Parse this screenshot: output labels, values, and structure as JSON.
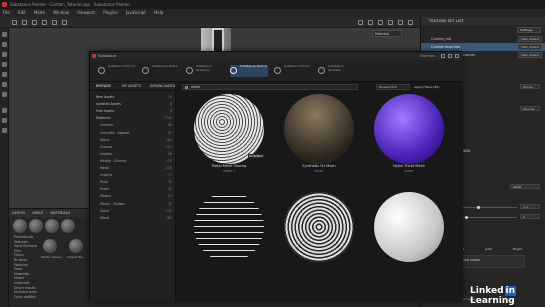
{
  "window": {
    "title": "Substance Painter - Curtain_Tutorial.spp - Substance Painter",
    "menu": [
      "File",
      "Edit",
      "Mode",
      "Window",
      "Viewport",
      "Plugins",
      "JavaScript",
      "Help"
    ]
  },
  "viewport": {
    "mode_dropdown": "Material"
  },
  "layers_panel": {
    "tabs": [
      "LAYERS",
      "SHELF",
      "MATERIALS"
    ],
    "list": [
      "Procedurals",
      "Textures",
      "Hard Surfaces",
      "Skin",
      "Filters",
      "Brushes",
      "Particles",
      "Tools",
      "Materials",
      "Smart materials",
      "Smart masks",
      "Environments",
      "Color profiles"
    ],
    "thumb_labels": [
      "Plastic Glossy",
      "Carpet Wo..."
    ]
  },
  "texture_set": {
    "header": "TEXTURE SET LIST",
    "settings_label": "Settings",
    "rows": [
      {
        "name": "Curtain_mtl",
        "shader": "Main shader",
        "selected": false
      },
      {
        "name": "Curtain machine",
        "shader": "Main shader",
        "selected": true
      },
      {
        "name": "Curtain machine sconces",
        "shader": "Main shader",
        "selected": false
      }
    ],
    "properties_header": "TEXTURE SET SETTINGS",
    "labels": [
      "Base Color",
      "Color selection",
      "Base Color",
      "Color selection",
      "Base Color",
      "Color selection",
      "Opacity",
      "Format",
      "Transparent",
      "Rotation",
      "Scale"
    ],
    "fields": [
      "Sticker",
      "Opacity",
      "sRGB",
      "1.0",
      "0"
    ],
    "buttons": [
      "Save",
      "Load",
      "Auto",
      "Bright"
    ],
    "sections": [
      "Attributes",
      "Channels mapping",
      "Parameters"
    ],
    "notice": "Substance source materials loader",
    "notice_sub": "Plastic Cool base Plaz...",
    "param_label": "Project",
    "param_value": "Select and apply"
  },
  "dialog": {
    "title": "Substance",
    "user": "Brandon",
    "nav": [
      {
        "label": "Substance Source",
        "active": false
      },
      {
        "label": "Substance Share",
        "active": false
      },
      {
        "label": "Substance Academy",
        "active": false
      },
      {
        "label": "Substance Source",
        "active": true
      },
      {
        "label": "Substance Forum",
        "active": false
      },
      {
        "label": "Substance Updates",
        "active": false
      }
    ],
    "side_tabs": [
      "BROWSE",
      "MY ASSETS",
      "DOWNLOADED"
    ],
    "side_rows": [
      {
        "label": "New Assets",
        "count": "10",
        "sub": false
      },
      {
        "label": "Updated Assets",
        "count": "8",
        "sub": false
      },
      {
        "label": "Free Assets",
        "count": "9",
        "sub": false
      },
      {
        "label": "Materials",
        "count": "1740",
        "sub": false
      },
      {
        "label": "Ceramic",
        "count": "66",
        "sub": true
      },
      {
        "label": "Concrete - Asphalt",
        "count": "97",
        "sub": true
      },
      {
        "label": "Fabric",
        "count": "184",
        "sub": true
      },
      {
        "label": "Ground",
        "count": "101",
        "sub": true
      },
      {
        "label": "Leather",
        "count": "58",
        "sub": true
      },
      {
        "label": "Marble - Granite",
        "count": "130",
        "sub": true
      },
      {
        "label": "Metal",
        "count": "216",
        "sub": true
      },
      {
        "label": "Organic",
        "count": "77",
        "sub": true
      },
      {
        "label": "Paint",
        "count": "70",
        "sub": true
      },
      {
        "label": "Paper",
        "count": "34",
        "sub": true
      },
      {
        "label": "Plaster",
        "count": "57",
        "sub": true
      },
      {
        "label": "Plastic - Rubber",
        "count": "72",
        "sub": true
      },
      {
        "label": "Stone",
        "count": "145",
        "sub": true
      },
      {
        "label": "Wood",
        "count": "185",
        "sub": true
      }
    ],
    "search_value": "mesh",
    "sort": "Newest first",
    "filter_button": "Apply Filters (85)",
    "cards": [
      {
        "name": "Metal Mesh Oblong",
        "sub": "SPENT 2",
        "badge": "DOWNLD"
      },
      {
        "name": "Synthetic Fiz Mesh",
        "sub": "SPENT",
        "badge": ""
      },
      {
        "name": "Nylon Tricot Mesh",
        "sub": "SPENT",
        "badge": ""
      },
      {
        "name": "",
        "sub": "",
        "badge": ""
      },
      {
        "name": "",
        "sub": "",
        "badge": ""
      },
      {
        "name": "",
        "sub": "",
        "badge": ""
      }
    ]
  },
  "watermark": {
    "text": "Linked",
    "in": "in",
    "suffix": " Learning"
  }
}
